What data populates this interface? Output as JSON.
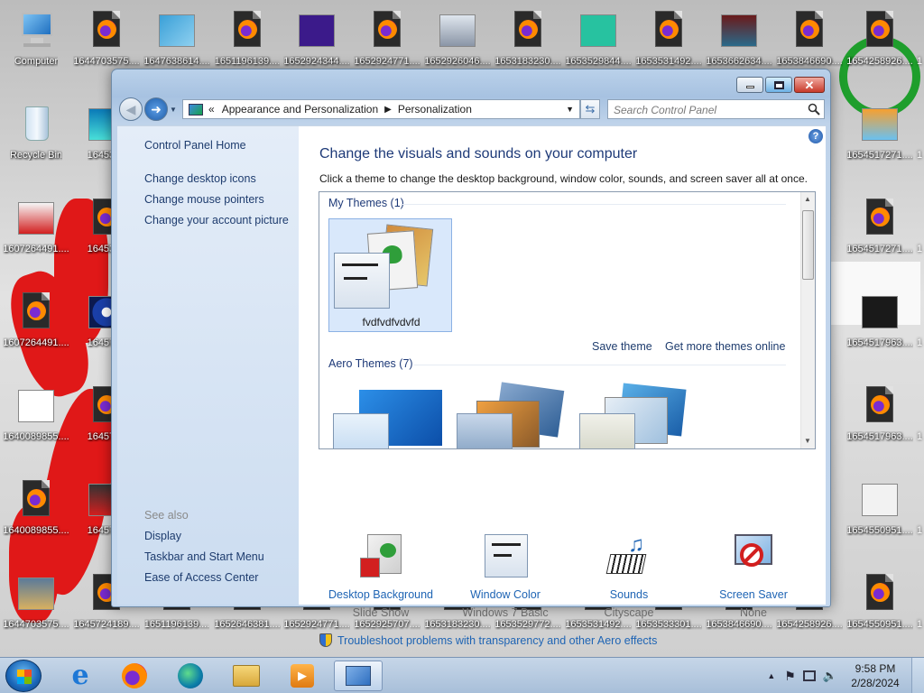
{
  "desktop": {
    "icons": [
      {
        "label": "Computer",
        "type": "computer"
      },
      {
        "label": "1644703575....",
        "type": "firefox"
      },
      {
        "label": "1647638614....",
        "type": "cat"
      },
      {
        "label": "1651196139....",
        "type": "firefox"
      },
      {
        "label": "1652924344....",
        "type": "purple"
      },
      {
        "label": "1652924771....",
        "type": "firefox"
      },
      {
        "label": "1652926046....",
        "type": "photo"
      },
      {
        "label": "1653183230....",
        "type": "firefox"
      },
      {
        "label": "1653529844....",
        "type": "camera"
      },
      {
        "label": "1653531492....",
        "type": "firefox"
      },
      {
        "label": "1653662634....",
        "type": "fox"
      },
      {
        "label": "1653846690....",
        "type": "firefox"
      },
      {
        "label": "1654258926....",
        "type": "firefox"
      },
      {
        "label": "Recycle Bin",
        "type": "recycle"
      },
      {
        "label": "1645304",
        "type": "photo2"
      },
      {
        "label": "1654517271....",
        "type": "cartoon"
      },
      {
        "label": "1607264491....",
        "type": "photo3"
      },
      {
        "label": "1645304",
        "type": "firefox"
      },
      {
        "label": "1654517271....",
        "type": "firefox"
      },
      {
        "label": "1607264491....",
        "type": "firefox"
      },
      {
        "label": "1645723",
        "type": "wdisc"
      },
      {
        "label": "1654517963....",
        "type": "phone"
      },
      {
        "label": "1640089855....",
        "type": "wnd"
      },
      {
        "label": "1645723",
        "type": "firefox"
      },
      {
        "label": "1654517963....",
        "type": "firefox"
      },
      {
        "label": "1640089855....",
        "type": "firefox"
      },
      {
        "label": "1645724",
        "type": "dark"
      },
      {
        "label": "1654550951....",
        "type": "virtel"
      },
      {
        "label": "1644703575....",
        "type": "raccoon"
      },
      {
        "label": "1645724189....",
        "type": "firefox"
      },
      {
        "label": "1651196139....",
        "type": "firefox"
      },
      {
        "label": "1652646381....",
        "type": "firefox"
      },
      {
        "label": "1652924771....",
        "type": "firefox"
      },
      {
        "label": "1652925707....",
        "type": "firefox"
      },
      {
        "label": "1653183230....",
        "type": "firefox"
      },
      {
        "label": "1653529772....",
        "type": "firefox"
      },
      {
        "label": "1653531492....",
        "type": "firefox"
      },
      {
        "label": "1653533301....",
        "type": "firefox"
      },
      {
        "label": "1653846690....",
        "type": "firefox"
      },
      {
        "label": "1654258926....",
        "type": "firefox"
      },
      {
        "label": "1654550951....",
        "type": "firefox"
      }
    ],
    "edge_labels": [
      "1",
      "1",
      "1",
      "1",
      "1",
      "1",
      "1"
    ]
  },
  "window": {
    "breadcrumb": {
      "overflow": "«",
      "items": [
        "Appearance and Personalization",
        "Personalization"
      ]
    },
    "search_placeholder": "Search Control Panel",
    "left_pane": {
      "home": "Control Panel Home",
      "links": [
        "Change desktop icons",
        "Change mouse pointers",
        "Change your account picture"
      ],
      "see_also_label": "See also",
      "see_also": [
        "Display",
        "Taskbar and Start Menu",
        "Ease of Access Center"
      ]
    },
    "content": {
      "title": "Change the visuals and sounds on your computer",
      "description": "Click a theme to change the desktop background, window color, sounds, and screen saver all at once.",
      "my_themes_header": "My Themes (1)",
      "my_theme_name": "fvdfvdfvdvfd",
      "save_theme": "Save theme",
      "get_more": "Get more themes online",
      "aero_header": "Aero Themes (7)",
      "bottom": [
        {
          "label": "Desktop Background",
          "sub": "Slide Show",
          "icon": "desktop-background-icon"
        },
        {
          "label": "Window Color",
          "sub": "Windows 7 Basic",
          "icon": "window-color-icon"
        },
        {
          "label": "Sounds",
          "sub": "Cityscape",
          "icon": "sounds-icon"
        },
        {
          "label": "Screen Saver",
          "sub": "None",
          "icon": "screen-saver-icon"
        }
      ],
      "troubleshoot": "Troubleshoot problems with transparency and other Aero effects"
    }
  },
  "taskbar": {
    "apps": [
      "internet-explorer",
      "firefox",
      "edge",
      "file-explorer",
      "media-player",
      "control-panel"
    ],
    "clock": {
      "time": "9:58 PM",
      "date": "2/28/2024"
    }
  },
  "colors": {
    "accent": "#1e64b4",
    "heading": "#1e3a78",
    "close": "#c8392a"
  }
}
